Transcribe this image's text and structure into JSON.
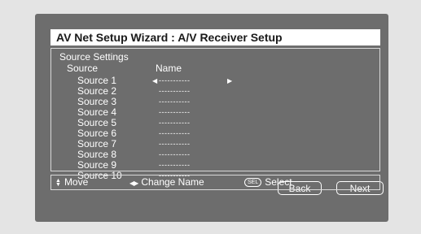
{
  "title": "AV Net Setup Wizard : A/V Receiver Setup",
  "section_title": "Source Settings",
  "columns": {
    "source": "Source",
    "name": "Name"
  },
  "sources": [
    {
      "label": "Source 1",
      "name": "-----------"
    },
    {
      "label": "Source 2",
      "name": "-----------"
    },
    {
      "label": "Source 3",
      "name": "-----------"
    },
    {
      "label": "Source 4",
      "name": "-----------"
    },
    {
      "label": "Source 5",
      "name": "-----------"
    },
    {
      "label": "Source 6",
      "name": "-----------"
    },
    {
      "label": "Source 7",
      "name": "-----------"
    },
    {
      "label": "Source 8",
      "name": "-----------"
    },
    {
      "label": "Source 9",
      "name": "-----------"
    },
    {
      "label": "Source 10",
      "name": "-----------"
    }
  ],
  "selected_index": 0,
  "buttons": {
    "back": "Back",
    "next": "Next"
  },
  "footer": {
    "move_label": "Move",
    "change_name_label": "Change Name",
    "sel_key": "SEL",
    "select_label": "Select"
  },
  "icons": {
    "move": "up-down-arrow-icon",
    "change_name": "left-right-arrow-icon",
    "select": "sel-key-icon",
    "name_prev": "left-triangle-icon",
    "name_next": "right-triangle-icon"
  },
  "colors": {
    "background": "#e4e4e4",
    "screen": "#6d6d6d",
    "title_bar": "#ffffff",
    "text": "#ffffff"
  }
}
